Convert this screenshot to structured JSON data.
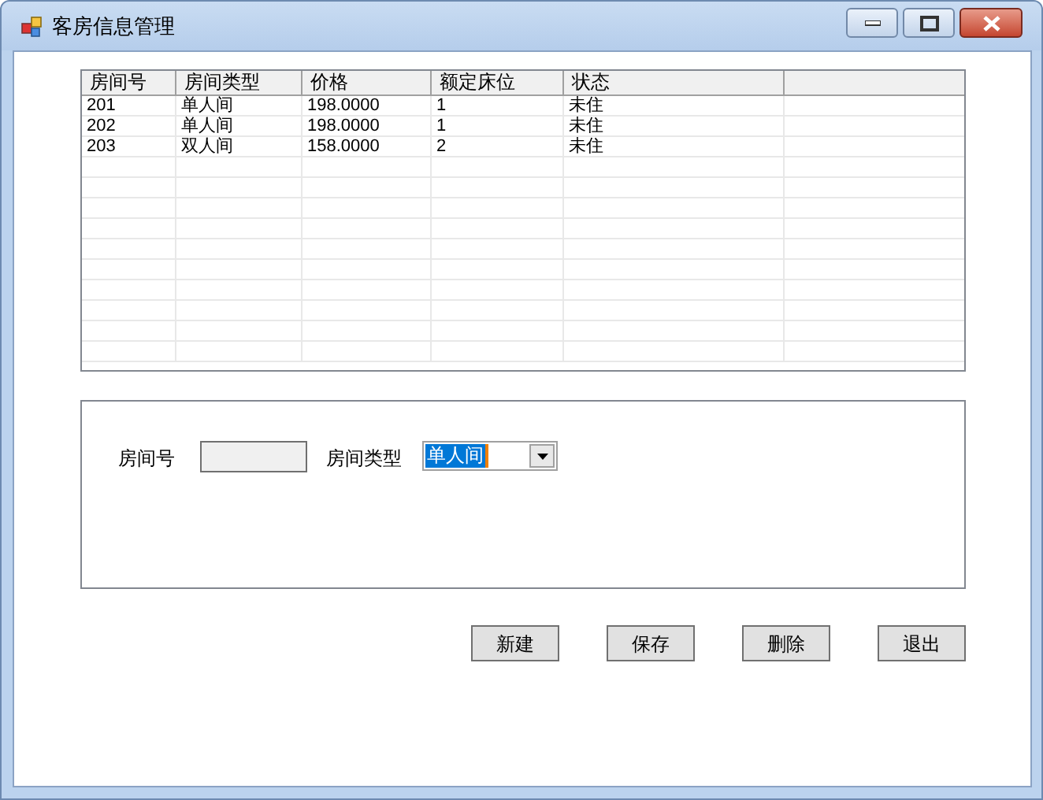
{
  "window": {
    "title": "客房信息管理"
  },
  "table": {
    "columns": [
      "房间号",
      "房间类型",
      "价格",
      "额定床位",
      "状态"
    ],
    "rows": [
      [
        "201",
        "单人间",
        "198.0000",
        "1",
        "未住"
      ],
      [
        "202",
        "单人间",
        "198.0000",
        "1",
        "未住"
      ],
      [
        "203",
        "双人间",
        "158.0000",
        "2",
        "未住"
      ]
    ]
  },
  "form": {
    "room_number": {
      "label": "房间号"
    },
    "room_type": {
      "label": "房间类型",
      "value": "单人间",
      "text_selected": true
    }
  },
  "buttons": [
    "新建",
    "保存",
    "删除",
    "退出"
  ]
}
